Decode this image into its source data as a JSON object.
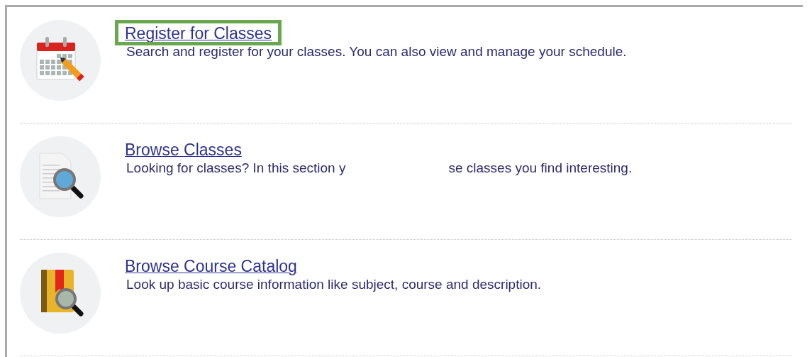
{
  "items": [
    {
      "kind": "calendar",
      "title": "Register for Classes",
      "highlighted": true,
      "description": [
        "Search and register for your classes. You can also view and manage your schedule."
      ]
    },
    {
      "kind": "document",
      "title": "Browse Classes",
      "highlighted": false,
      "description": [
        "Looking for classes? In this section y",
        "se classes you find interesting."
      ]
    },
    {
      "kind": "book",
      "title": "Browse Course Catalog",
      "highlighted": false,
      "description": [
        "Look up basic course information like subject, course and description."
      ]
    }
  ]
}
